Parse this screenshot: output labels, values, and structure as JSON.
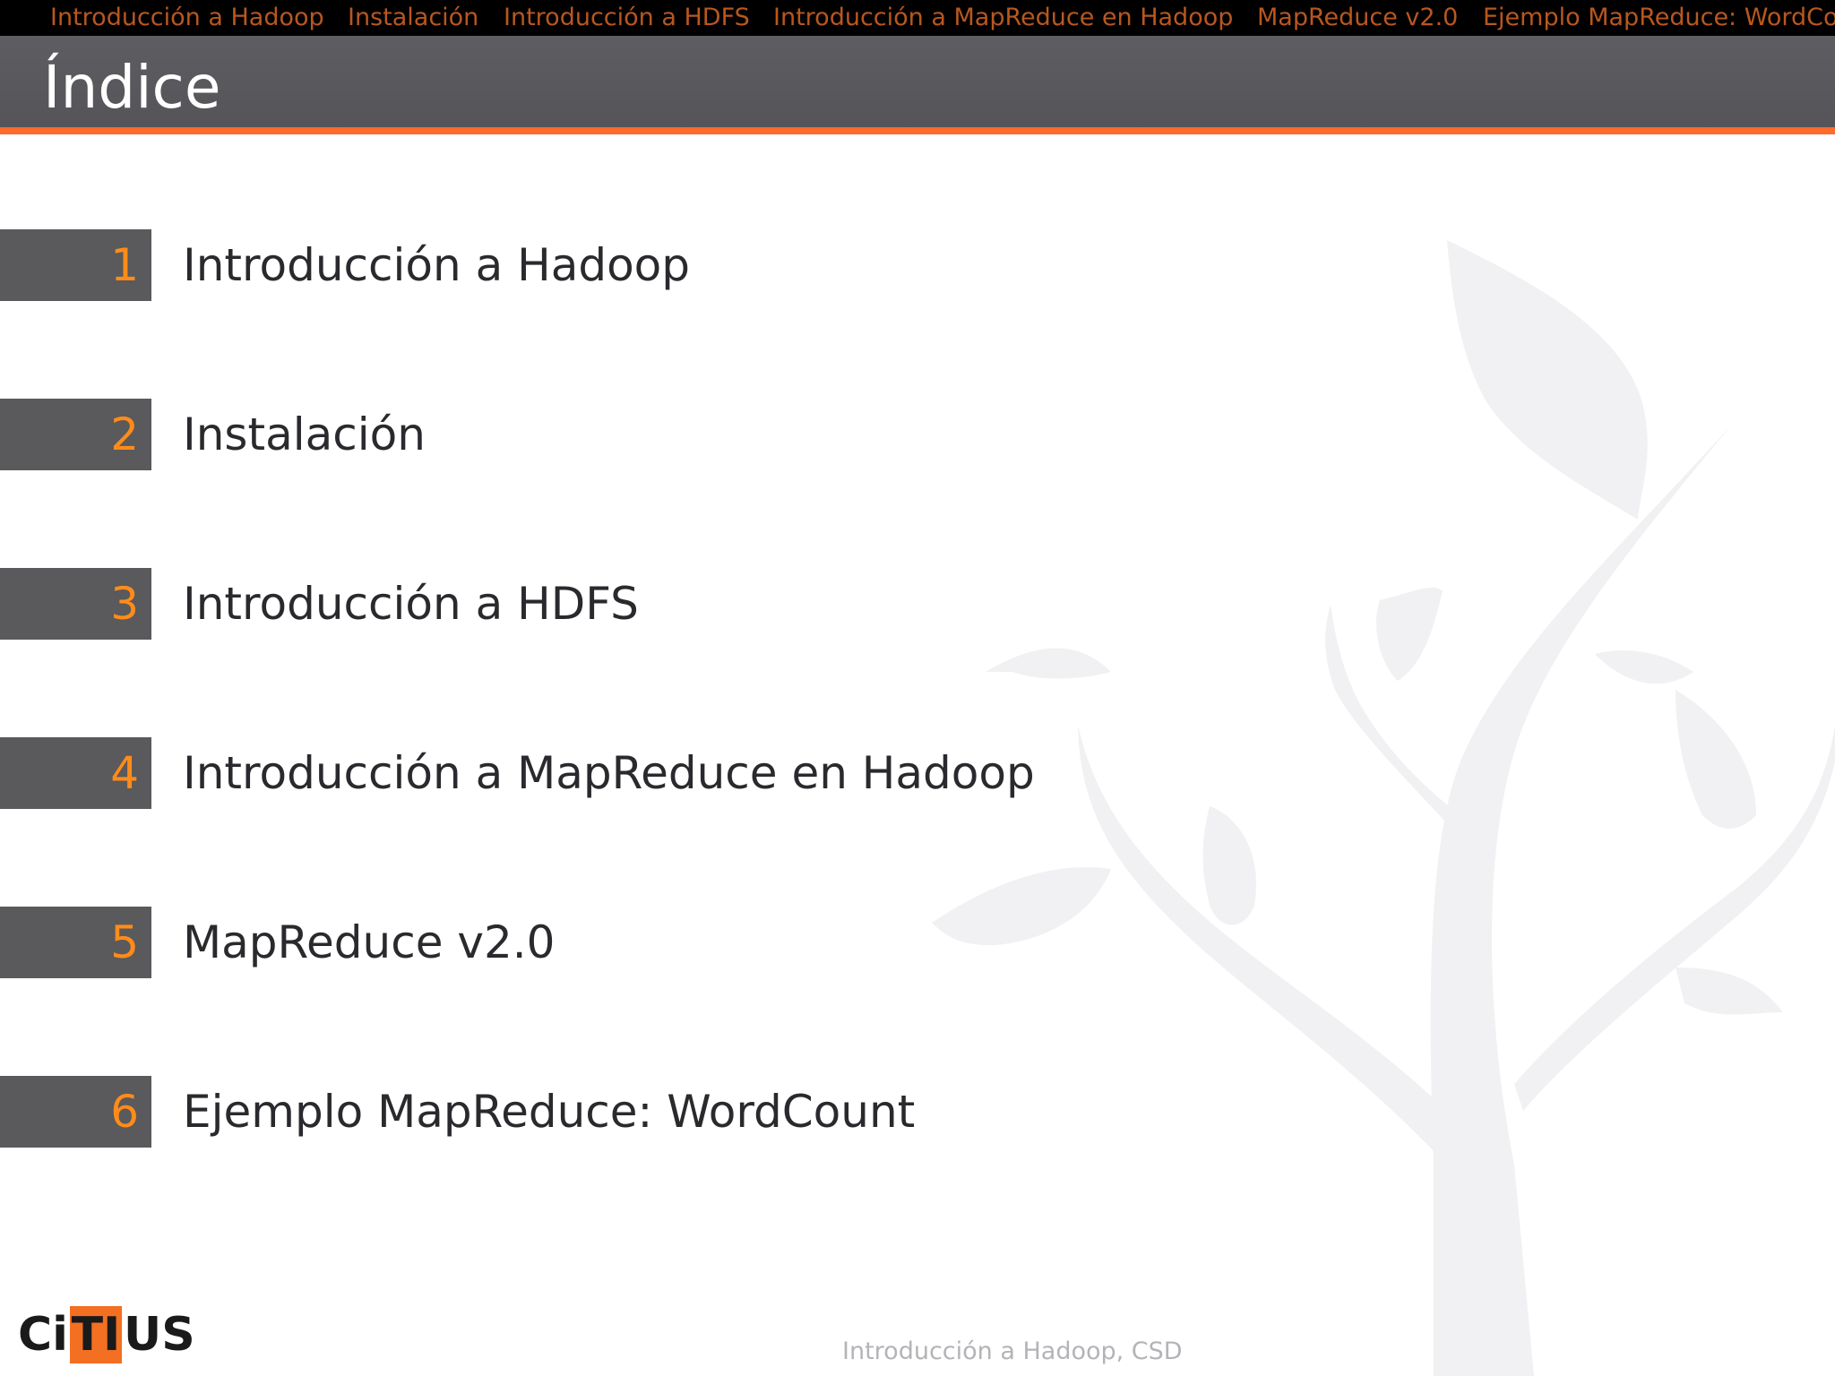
{
  "nav": {
    "items": [
      {
        "label": "Introducción a Hadoop"
      },
      {
        "label": "Instalación"
      },
      {
        "label": "Introducción a HDFS"
      },
      {
        "label": "Introducción a MapReduce en Hadoop"
      },
      {
        "label": "MapReduce v2.0"
      },
      {
        "label": "Ejemplo MapReduce: WordCount"
      }
    ]
  },
  "slide": {
    "title": "Índice"
  },
  "toc": {
    "items": [
      {
        "number": "1",
        "label": "Introducción a Hadoop"
      },
      {
        "number": "2",
        "label": "Instalación"
      },
      {
        "number": "3",
        "label": "Introducción a HDFS"
      },
      {
        "number": "4",
        "label": "Introducción a MapReduce en Hadoop"
      },
      {
        "number": "5",
        "label": "MapReduce v2.0"
      },
      {
        "number": "6",
        "label": "Ejemplo MapReduce: WordCount"
      }
    ]
  },
  "logo": {
    "part1": "Ci",
    "part2": "TI",
    "part3": "US"
  },
  "footer": {
    "text": "Introducción a Hadoop, CSD"
  },
  "colors": {
    "accent": "#ff6a2d",
    "number": "#ff8c19",
    "bar": "#5a595c",
    "nav_text": "#b8571f"
  }
}
